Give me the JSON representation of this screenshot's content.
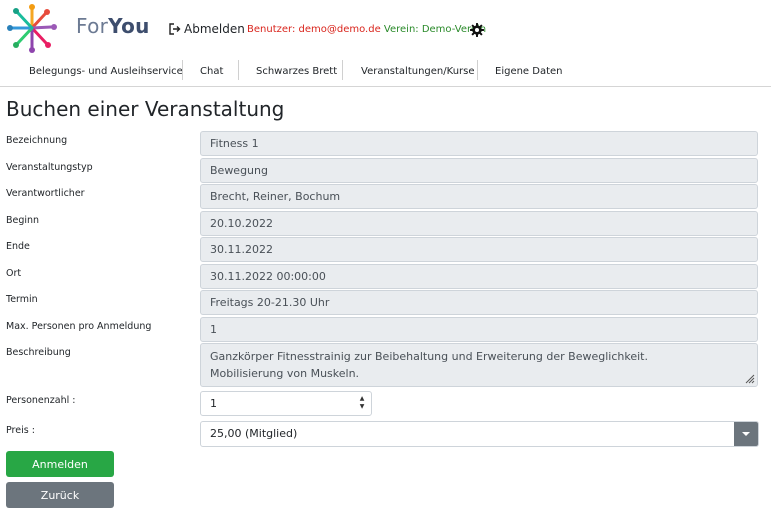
{
  "header": {
    "brand_prefix": "For",
    "brand_suffix": "You",
    "logout_label": "Abmelden",
    "user_text": "Benutzer: demo@demo.de",
    "club_text": "Verein: Demo-Verein"
  },
  "nav": {
    "items": [
      {
        "label": "Belegungs- und Ausleihservice"
      },
      {
        "label": "Chat"
      },
      {
        "label": "Schwarzes Brett"
      },
      {
        "label": "Veranstaltungen/Kurse"
      },
      {
        "label": "Eigene Daten"
      }
    ]
  },
  "page_title": "Buchen einer Veranstaltung",
  "fields": [
    {
      "label": "Bezeichnung",
      "value": "Fitness 1"
    },
    {
      "label": "Veranstaltungstyp",
      "value": "Bewegung"
    },
    {
      "label": "Verantwortlicher",
      "value": "Brecht, Reiner, Bochum"
    },
    {
      "label": "Beginn",
      "value": "20.10.2022"
    },
    {
      "label": "Ende",
      "value": "30.11.2022"
    },
    {
      "label": "Ort",
      "value": "30.11.2022 00:00:00"
    },
    {
      "label": "Termin",
      "value": "Freitags  20-21.30 Uhr"
    },
    {
      "label": "Max. Personen pro Anmeldung",
      "value": "1"
    }
  ],
  "description": {
    "label": "Beschreibung",
    "line1": "Ganzkörper Fitnesstrainig zur Beibehaltung und Erweiterung der Beweglichkeit.",
    "line2": "Mobilisierung von Muskeln."
  },
  "persons": {
    "label": "Personenzahl :",
    "value": "1"
  },
  "price": {
    "label": "Preis :",
    "selected": "25,00 (Mitglied)"
  },
  "buttons": {
    "register": "Anmelden",
    "back": "Zurück"
  },
  "colors": {
    "primary_button": "#28a745",
    "secondary_button": "#6c757d",
    "user_text": "#d9251d",
    "club_text": "#2a8a2a"
  }
}
